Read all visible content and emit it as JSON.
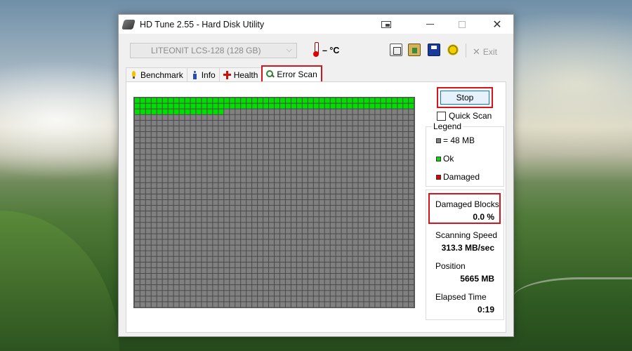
{
  "window": {
    "title": "HD Tune 2.55 - Hard Disk Utility"
  },
  "toolbar": {
    "drive": "LITEONIT LCS-128 (128 GB)",
    "temperature": "– °C",
    "exit_label": "Exit",
    "icons": [
      "copy-icon",
      "paste-icon",
      "save-icon",
      "options-icon"
    ]
  },
  "tabs": [
    {
      "label": "Benchmark",
      "icon": "benchmark-icon"
    },
    {
      "label": "Info",
      "icon": "info-icon"
    },
    {
      "label": "Health",
      "icon": "health-icon"
    },
    {
      "label": "Error Scan",
      "icon": "error-scan-icon",
      "active": true
    }
  ],
  "scan": {
    "stop_label": "Stop",
    "quick_scan_label": "Quick Scan",
    "quick_scan_checked": false,
    "grid": {
      "cols": 50,
      "rows": 37,
      "ok_blocks": 116
    }
  },
  "legend": {
    "title": "Legend",
    "items": [
      {
        "label": "= 48 MB",
        "color": "#808080"
      },
      {
        "label": "Ok",
        "color": "#00e000"
      },
      {
        "label": "Damaged",
        "color": "#e00000"
      }
    ]
  },
  "stats": {
    "damaged_blocks_label": "Damaged Blocks",
    "damaged_blocks_value": "0.0 %",
    "scanning_speed_label": "Scanning Speed",
    "scanning_speed_value": "313.3 MB/sec",
    "position_label": "Position",
    "position_value": "5665 MB",
    "elapsed_time_label": "Elapsed Time",
    "elapsed_time_value": "0:19"
  },
  "colors": {
    "highlight": "#d6141c",
    "ok_block": "#00e000",
    "unscanned_block": "#808080"
  }
}
